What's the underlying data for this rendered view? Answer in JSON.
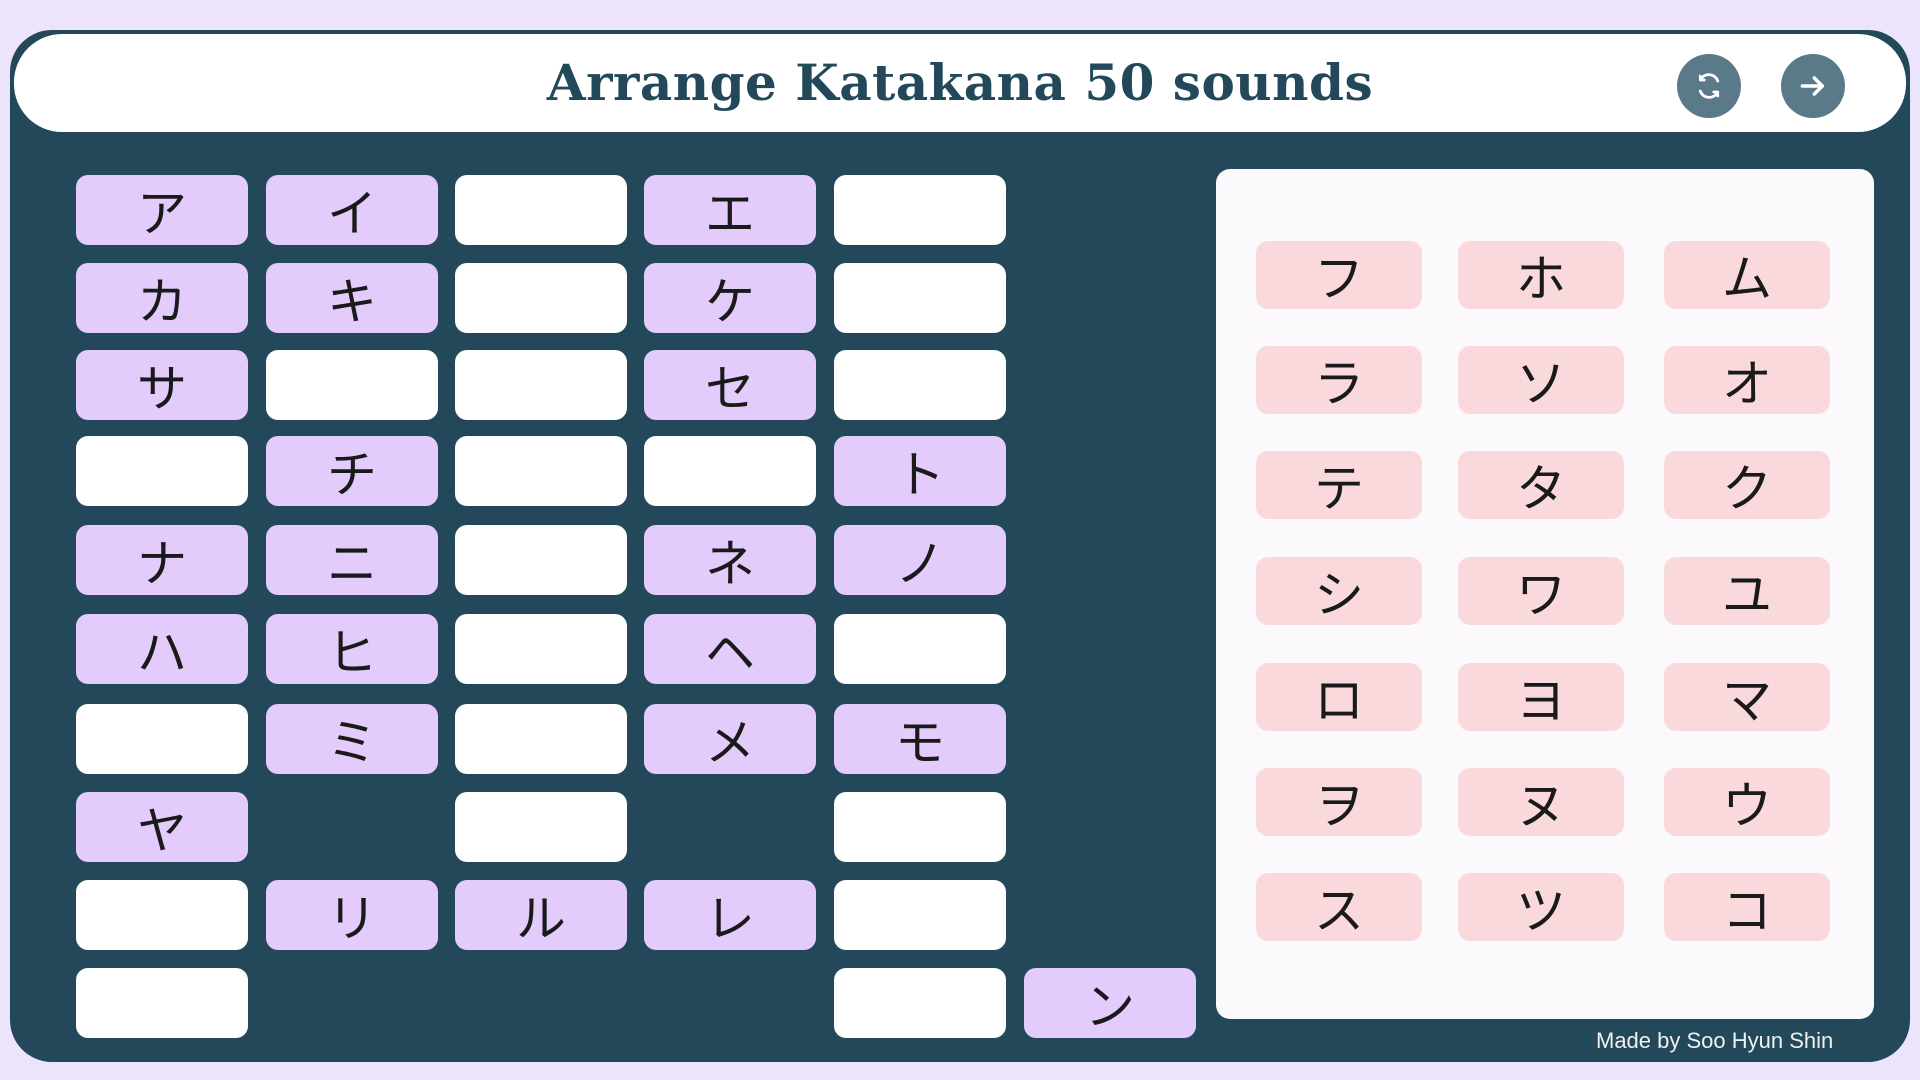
{
  "header": {
    "title": "Arrange Katakana 50 sounds",
    "reset_icon": "refresh-icon",
    "next_icon": "arrow-right-icon"
  },
  "grid": {
    "rows": [
      [
        "ア",
        "イ",
        "",
        "エ",
        ""
      ],
      [
        "カ",
        "キ",
        "",
        "ケ",
        ""
      ],
      [
        "サ",
        "",
        "",
        "セ",
        ""
      ],
      [
        "",
        "チ",
        "",
        "",
        "ト"
      ],
      [
        "ナ",
        "ニ",
        "",
        "ネ",
        "ノ"
      ],
      [
        "ハ",
        "ヒ",
        "",
        "ヘ",
        ""
      ],
      [
        "",
        "ミ",
        "",
        "メ",
        "モ"
      ],
      [
        "ヤ",
        null,
        "",
        null,
        ""
      ],
      [
        "",
        "リ",
        "ル",
        "レ",
        ""
      ],
      [
        "",
        null,
        null,
        null,
        "",
        "ン"
      ]
    ]
  },
  "pool": {
    "tiles": [
      "フ",
      "ホ",
      "ム",
      "ラ",
      "ソ",
      "オ",
      "テ",
      "タ",
      "ク",
      "シ",
      "ワ",
      "ユ",
      "ロ",
      "ヨ",
      "マ",
      "ヲ",
      "ヌ",
      "ウ",
      "ス",
      "ツ",
      "コ"
    ]
  },
  "footer": {
    "credit": "Made by Soo Hyun Shin"
  },
  "colors": {
    "frame": "#22485a",
    "filled_cell": "#e3ccfb",
    "empty_cell": "#ffffff",
    "pool_tile": "#fad9dd",
    "page_background": "#ebe4fa"
  }
}
